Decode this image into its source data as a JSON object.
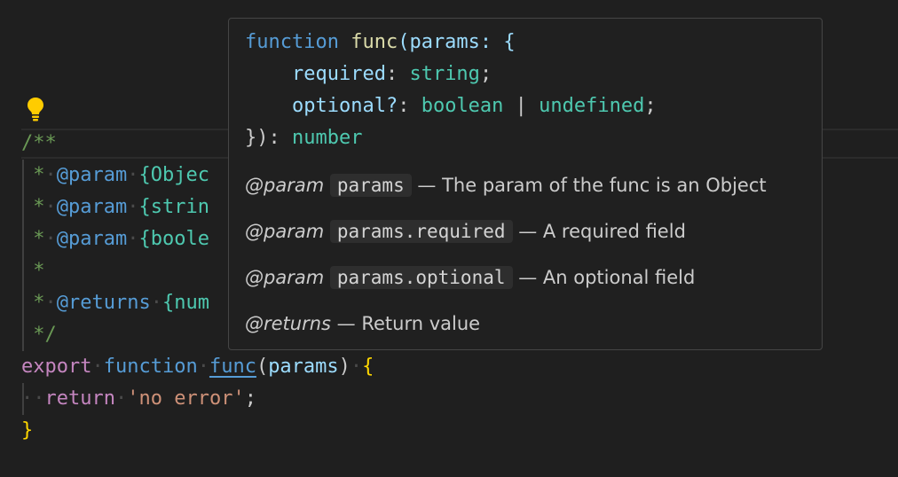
{
  "editor": {
    "lines": {
      "doc_open": "/**",
      "doc_star": "*",
      "tag_param": "@param",
      "tag_returns": "@returns",
      "type_object_partial": "{Objec",
      "type_string_partial": "{strin",
      "type_boolean_partial": "{boole",
      "type_number_partial": "{num",
      "doc_close": "*/",
      "kw_export": "export",
      "kw_function": "function",
      "fn_name": "func",
      "open_paren": "(",
      "param_name": "params",
      "close_paren": ")",
      "open_brace": "{",
      "kw_return": "return",
      "return_value": "'no error'",
      "semicolon": ";",
      "close_brace": "}"
    },
    "colors": {
      "background": "#1f1f1f",
      "comment": "#6a9955",
      "keyword": "#c586c0",
      "storage": "#569cd6",
      "type": "#4ec9b0",
      "string": "#ce9178",
      "variable": "#9cdcfe",
      "bracket": "#ffd700",
      "lightbulb": "#ffcc00"
    }
  },
  "hover": {
    "signature": {
      "kw_function": "function",
      "fn_name": "func",
      "open": "(params: {",
      "param_required": "required",
      "type_string": "string",
      "param_optional": "optional?",
      "type_boolean": "boolean",
      "pipe": "|",
      "type_undefined": "undefined",
      "close": "}): ",
      "type_number": "number"
    },
    "docs": [
      {
        "tag": "@param",
        "name": "params",
        "description": "— The param of the func is an Object"
      },
      {
        "tag": "@param",
        "name": "params.required",
        "description": "— A required field"
      },
      {
        "tag": "@param",
        "name": "params.optional",
        "description": "— An optional field"
      }
    ],
    "returns": {
      "tag": "@returns",
      "description": "— Return value"
    }
  }
}
